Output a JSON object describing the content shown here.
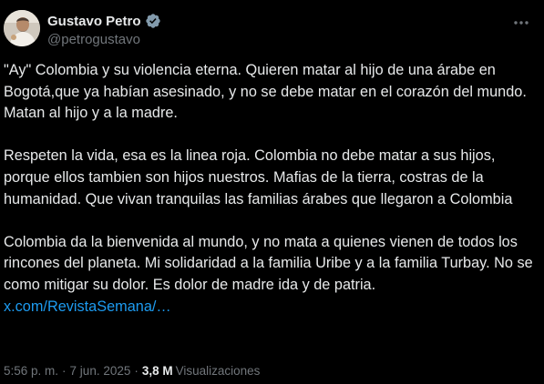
{
  "author": {
    "display_name": "Gustavo Petro",
    "handle": "@petrogustavo",
    "verified": true
  },
  "tweet": {
    "paragraphs": [
      "\"Ay\" Colombia y su violencia eterna. Quieren matar al hijo de una árabe en Bogotá,que ya habían asesinado, y no se debe matar en el corazón del mundo. Matan al hijo y a la madre.",
      "Respeten la vida, esa es la linea roja. Colombia no debe matar a sus hijos, porque ellos tambien son hijos nuestros. Mafias de la tierra, costras de la humanidad. Que vivan tranquilas las familias árabes que llegaron a Colombia"
    ],
    "last_paragraph": "Colombia da la bienvenida al mundo, y no mata a quienes vienen de todos los rincones del planeta. Mi solidaridad a la familia Uribe y a la familia Turbay. No se como mitigar su dolor. Es dolor de madre ida y de patria.",
    "link_text": "x.com/RevistaSemana/…"
  },
  "meta": {
    "time": "5:56 p. m.",
    "separator": "·",
    "date": "7 jun. 2025",
    "views_count": "3,8 M",
    "views_label": "Visualizaciones"
  },
  "icons": {
    "verified": "verified-badge-icon",
    "more": "more-options-icon"
  },
  "colors": {
    "background": "#000000",
    "text_primary": "#e7e9ea",
    "text_secondary": "#71767b",
    "link": "#1d9bf0",
    "verified_badge": "#829aab"
  }
}
